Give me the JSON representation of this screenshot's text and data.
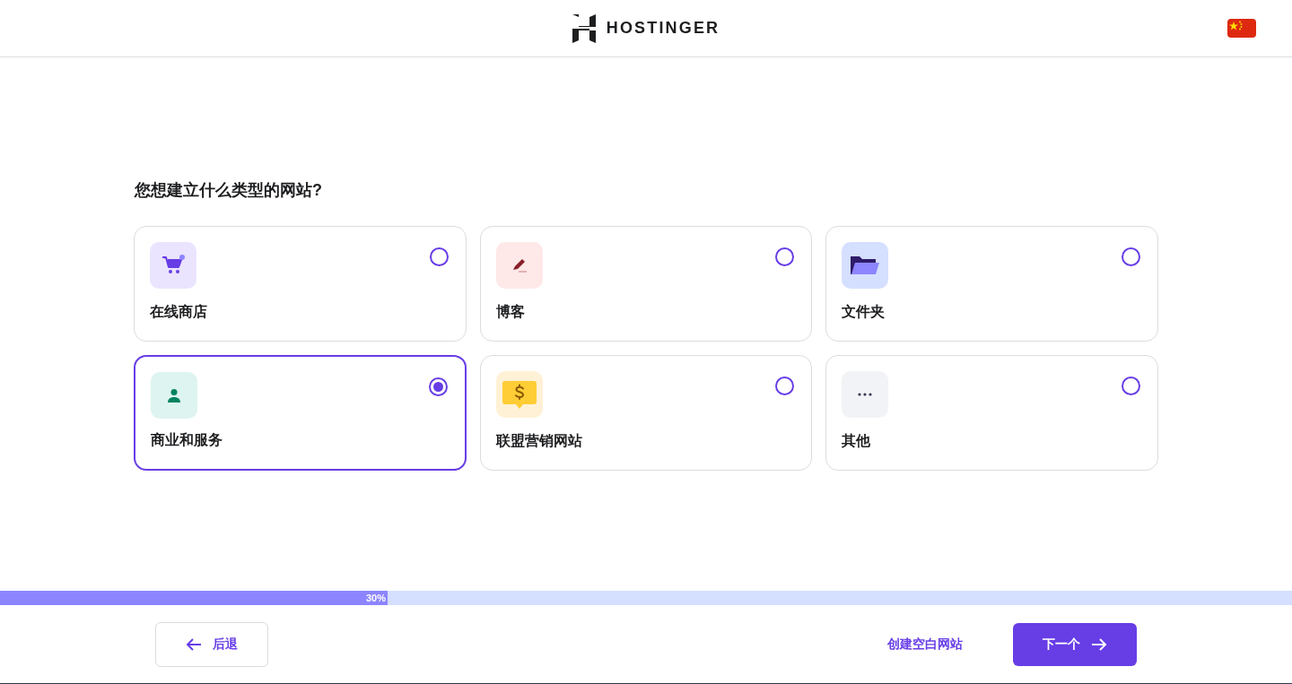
{
  "header": {
    "brand": "HOSTINGER"
  },
  "question": "您想建立什么类型的网站?",
  "options": [
    {
      "kind": "cart",
      "label": "在线商店",
      "selected": false
    },
    {
      "kind": "pen",
      "label": "博客",
      "selected": false
    },
    {
      "kind": "folder",
      "label": "文件夹",
      "selected": false
    },
    {
      "kind": "person",
      "label": "商业和服务",
      "selected": true
    },
    {
      "kind": "dollar",
      "label": "联盟营销网站",
      "selected": false
    },
    {
      "kind": "dots",
      "label": "其他",
      "selected": false
    }
  ],
  "progress": {
    "level": 0.3,
    "reading": "30%"
  },
  "footer": {
    "back": "后退",
    "blank_site_link": "创建空白网站",
    "next": "下一个"
  }
}
